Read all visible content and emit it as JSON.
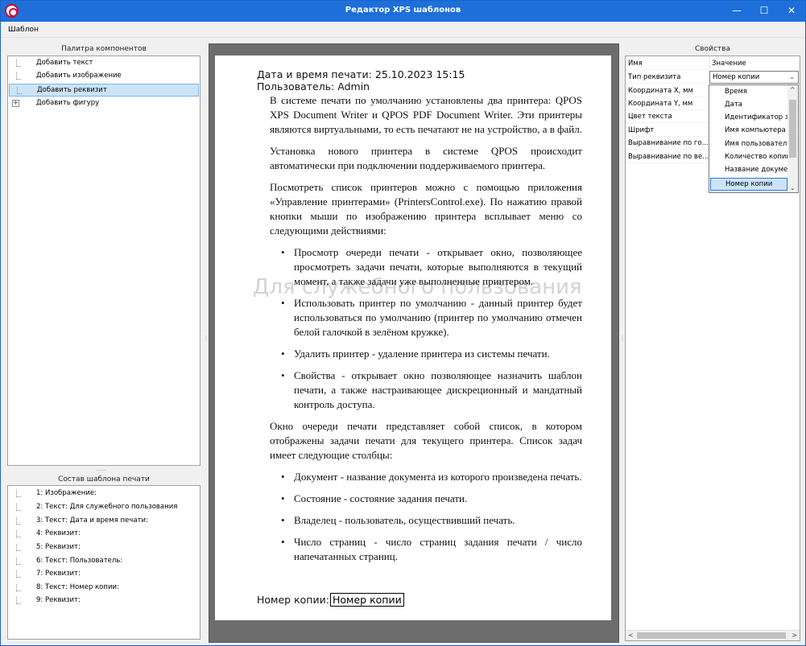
{
  "window": {
    "title": "Редактор XPS шаблонов",
    "minimize": "—",
    "maximize": "☐",
    "close": "✕"
  },
  "menu": {
    "template": "Шаблон"
  },
  "palette": {
    "title": "Палитра компонентов",
    "items": [
      "Добавить текст",
      "Добавить изображение",
      "Добавить реквизит",
      "Добавить фигуру"
    ],
    "selected": "Добавить реквизит"
  },
  "composition": {
    "title": "Состав шаблона печати",
    "items": [
      "1: Изображение:",
      "2: Текст: Для служебного пользования",
      "3: Текст: Дата и время печати:",
      "4: Реквизит:",
      "5: Реквизит:",
      "6: Текст: Пользователь:",
      "7: Реквизит:",
      "8: Текст: Номер копии:",
      "9: Реквизит:"
    ]
  },
  "document": {
    "print_time_label": "Дата и время печати:",
    "print_time_value": "25.10.2023 15:15",
    "user_label": "Пользователь:",
    "user_value": "Admin",
    "watermark": "Для служебного пользования",
    "p1": "В системе печати по умолчанию установлены два принтера: QPOS XPS Document Writer и QPOS PDF Document Writer. Эти принтеры являются виртуальными, то есть печатают не на устройство, а в файл.",
    "p2": "Установка нового принтера в системе QPOS происходит автоматически при подключении поддерживаемого принтера.",
    "p3": "Посмотреть список принтеров можно с помощью приложения «Управление принтерами» (PrintersControl.exe). По нажатию правой кнопки мыши по изображению принтера всплывает меню со следующими действиями:",
    "bullets1": [
      "Просмотр очереди печати - открывает окно, позволяющее просмотреть задачи печати, которые выполняются в текущий момент, а также задачи уже выполненные принтером.",
      "Использовать принтер по умолчанию - данный принтер будет использоваться по умолчанию (принтер по умолчанию отмечен белой галочкой в зелёном кружке).",
      "Удалить принтер - удаление принтера из системы печати.",
      "Свойства - открывает окно позволяющее назначить шаблон печати, а также настраивающее дискреционный и мандатный контроль доступа."
    ],
    "p4": "Окно очереди печати представляет собой список, в котором отображены задачи печати для текущего принтера. Список задач имеет следующие столбцы:",
    "bullets2": [
      "Документ - название документа из которого произведена печать.",
      "Состояние - состояние задания печати.",
      "Владелец - пользователь, осуществивший печать.",
      "Число страниц - число страниц задания печати / число напечатанных страниц."
    ],
    "copy_label": "Номер копии:",
    "copy_value": "Номер копии"
  },
  "properties": {
    "title": "Свойства",
    "header_name": "Имя",
    "header_value": "Значение",
    "rows": [
      "Тип реквизита",
      "Координата X, мм",
      "Координата Y, мм",
      "Цвет текста",
      "Шрифт",
      "Выравнивание по го...",
      "Выравнивание по ве..."
    ],
    "combo_value": "Номер копии",
    "options": [
      "Время",
      "Дата",
      "Идентификатор за",
      "Имя компьютера",
      "Имя пользователя",
      "Количество копий",
      "Название докумен",
      "Номер копии"
    ],
    "selected_option": "Номер копии"
  }
}
